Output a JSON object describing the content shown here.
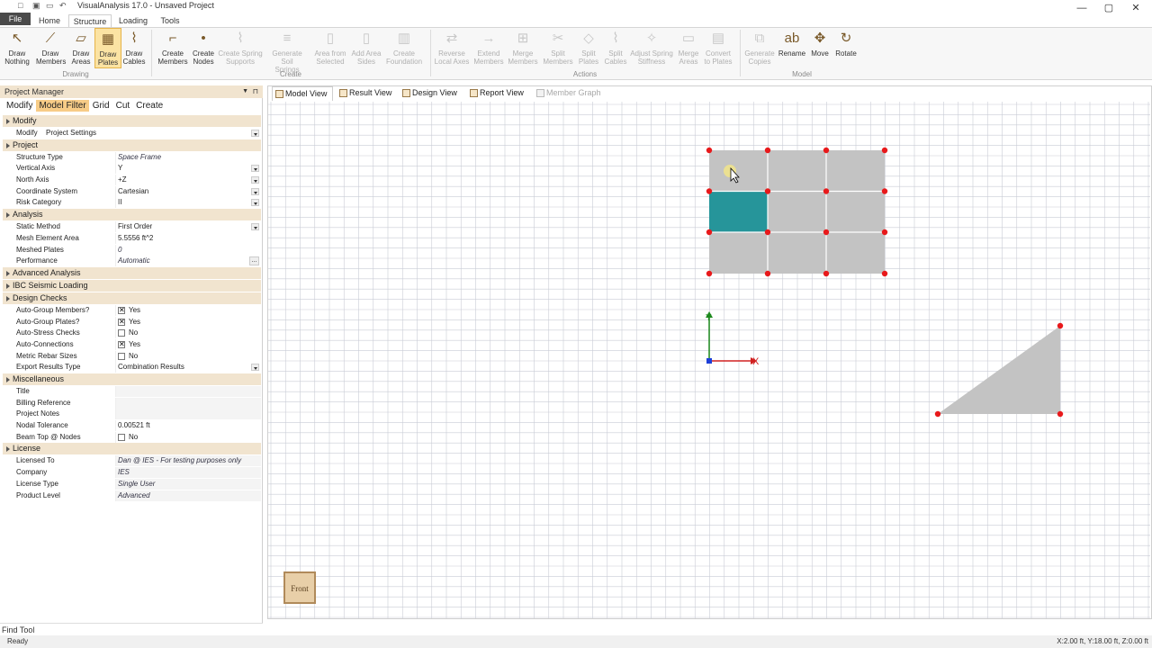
{
  "window": {
    "title": "VisualAnalysis 17.0 - Unsaved Project",
    "file_button": "File",
    "minimize": "—",
    "maximize": "▢",
    "close": "✕"
  },
  "ribbon_tabs": [
    "Home",
    "Structure",
    "Loading",
    "Tools"
  ],
  "active_ribbon_tab": "Structure",
  "ribbon": {
    "drawing_group": "Drawing",
    "create_group": "Create",
    "actions_group": "Actions",
    "model_group": "Model",
    "buttons": [
      {
        "label1": "Draw",
        "label2": "Nothing",
        "icon": "pointer-icon"
      },
      {
        "label1": "Draw",
        "label2": "Members",
        "icon": "member-icon"
      },
      {
        "label1": "Draw",
        "label2": "Areas",
        "icon": "area-icon"
      },
      {
        "label1": "Draw",
        "label2": "Plates",
        "icon": "plate-icon"
      },
      {
        "label1": "Draw",
        "label2": "Cables",
        "icon": "cable-icon"
      },
      {
        "label1": "Create",
        "label2": "Members",
        "icon": "create-member-icon"
      },
      {
        "label1": "Create",
        "label2": "Nodes",
        "icon": "node-icon"
      },
      {
        "label1": "Create Spring",
        "label2": "Supports",
        "icon": "spring-icon"
      },
      {
        "label1": "Generate Soil",
        "label2": "Springs",
        "icon": "soil-icon"
      },
      {
        "label1": "Area from",
        "label2": "Selected",
        "icon": "area-select-icon"
      },
      {
        "label1": "Add Area",
        "label2": "Sides",
        "icon": "area-sides-icon"
      },
      {
        "label1": "Create",
        "label2": "Foundation",
        "icon": "foundation-icon"
      },
      {
        "label1": "Reverse",
        "label2": "Local Axes",
        "icon": "reverse-icon"
      },
      {
        "label1": "Extend",
        "label2": "Members",
        "icon": "extend-icon"
      },
      {
        "label1": "Merge",
        "label2": "Members",
        "icon": "merge-icon"
      },
      {
        "label1": "Split",
        "label2": "Members",
        "icon": "split-icon"
      },
      {
        "label1": "Split",
        "label2": "Plates",
        "icon": "split-plates-icon"
      },
      {
        "label1": "Split",
        "label2": "Cables",
        "icon": "split-cables-icon"
      },
      {
        "label1": "Adjust Spring",
        "label2": "Stiffness",
        "icon": "adjust-icon"
      },
      {
        "label1": "Merge",
        "label2": "Areas",
        "icon": "merge-areas-icon"
      },
      {
        "label1": "Convert",
        "label2": "to Plates",
        "icon": "convert-icon"
      },
      {
        "label1": "Generate",
        "label2": "Copies",
        "icon": "copies-icon"
      },
      {
        "label1": "Rename",
        "label2": "",
        "icon": "rename-icon"
      },
      {
        "label1": "Move",
        "label2": "",
        "icon": "move-icon"
      },
      {
        "label1": "Rotate",
        "label2": "",
        "icon": "rotate-icon"
      }
    ]
  },
  "project_manager": {
    "title": "Project Manager",
    "tabs": [
      "Modify",
      "Model Filter",
      "Grid",
      "Cut",
      "Create"
    ],
    "active_tab": "Model Filter",
    "sections": {
      "modify": "Modify",
      "project": "Project",
      "analysis": "Analysis",
      "advanced": "Advanced Analysis",
      "ibc": "IBC Seismic Loading",
      "design": "Design Checks",
      "misc": "Miscellaneous",
      "license": "License"
    },
    "modify_row": {
      "label": "Modify",
      "value": "Project Settings"
    },
    "project_rows": [
      {
        "label": "Structure Type",
        "value": "Space Frame"
      },
      {
        "label": "Vertical Axis",
        "value": "Y"
      },
      {
        "label": "North Axis",
        "value": "+Z"
      },
      {
        "label": "Coordinate System",
        "value": "Cartesian"
      },
      {
        "label": "Risk Category",
        "value": "II"
      }
    ],
    "analysis_rows": [
      {
        "label": "Static Method",
        "value": "First Order"
      },
      {
        "label": "Mesh Element Area",
        "value": "5.5556 ft^2"
      },
      {
        "label": "Meshed Plates",
        "value": "0"
      },
      {
        "label": "Performance",
        "value": "Automatic"
      }
    ],
    "design_rows": [
      {
        "label": "Auto-Group Members?",
        "value": "Yes",
        "checked": true
      },
      {
        "label": "Auto-Group Plates?",
        "value": "Yes",
        "checked": true
      },
      {
        "label": "Auto-Stress Checks",
        "value": "No",
        "checked": false
      },
      {
        "label": "Auto-Connections",
        "value": "Yes",
        "checked": true
      },
      {
        "label": "Metric Rebar Sizes",
        "value": "No",
        "checked": false
      },
      {
        "label": "Export Results Type",
        "value": "Combination Results"
      }
    ],
    "misc_rows": [
      {
        "label": "Title",
        "value": ""
      },
      {
        "label": "Billing Reference",
        "value": ""
      },
      {
        "label": "Project Notes",
        "value": ""
      },
      {
        "label": "Nodal Tolerance",
        "value": "0.00521 ft"
      },
      {
        "label": "Beam Top @ Nodes",
        "value": "No",
        "checked": false
      }
    ],
    "license_rows": [
      {
        "label": "Licensed To",
        "value": "Dan @ IES - For testing purposes only"
      },
      {
        "label": "Company",
        "value": "IES"
      },
      {
        "label": "License Type",
        "value": "Single User"
      },
      {
        "label": "Product Level",
        "value": "Advanced"
      }
    ]
  },
  "view_tabs": [
    "Model View",
    "Result View",
    "Design View",
    "Report View",
    "Member Graph"
  ],
  "active_view_tab": "Model View",
  "view_cube": "Front",
  "axes": {
    "x": "X",
    "y": "Y"
  },
  "find_tool": "Find Tool",
  "status": {
    "left": "Ready",
    "coords": "X:2.00 ft, Y:18.00 ft, Z:0.00 ft"
  },
  "colors": {
    "accent": "#f7cc87",
    "selected_plate": "#26959a",
    "plate": "#c3c3c3",
    "node": "#e8191b"
  }
}
